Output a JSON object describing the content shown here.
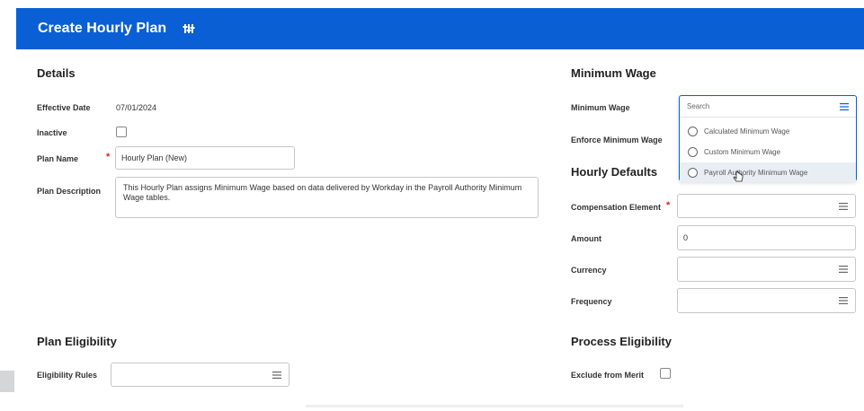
{
  "header": {
    "title": "Create Hourly Plan",
    "settings_icon": "related-actions-icon"
  },
  "details": {
    "title": "Details",
    "effective_date_label": "Effective Date",
    "effective_date_value": "07/01/2024",
    "inactive_label": "Inactive",
    "inactive_checked": false,
    "plan_name_label": "Plan Name",
    "plan_name_value": "Hourly Plan (New)",
    "plan_description_label": "Plan Description",
    "plan_description_value": "This Hourly Plan assigns Minimum Wage based on data delivered by Workday in the Payroll Authority Minimum Wage tables."
  },
  "minimum_wage": {
    "title": "Minimum Wage",
    "minimum_wage_label": "Minimum Wage",
    "enforce_label": "Enforce Minimum Wage",
    "search_placeholder": "Search",
    "options": [
      {
        "label": "Calculated Minimum Wage"
      },
      {
        "label": "Custom Minimum Wage"
      },
      {
        "label": "Payroll Authority Minimum Wage"
      }
    ]
  },
  "hourly_defaults": {
    "title": "Hourly Defaults",
    "compensation_element_label": "Compensation Element",
    "amount_label": "Amount",
    "amount_value": "0",
    "currency_label": "Currency",
    "frequency_label": "Frequency"
  },
  "plan_eligibility": {
    "title": "Plan Eligibility",
    "eligibility_rules_label": "Eligibility Rules"
  },
  "process_eligibility": {
    "title": "Process Eligibility",
    "exclude_from_merit_label": "Exclude from Merit",
    "exclude_from_merit_checked": false
  },
  "required_marker": "*",
  "colors": {
    "header_bg": "#0a5fd4",
    "required": "#d0271d"
  }
}
